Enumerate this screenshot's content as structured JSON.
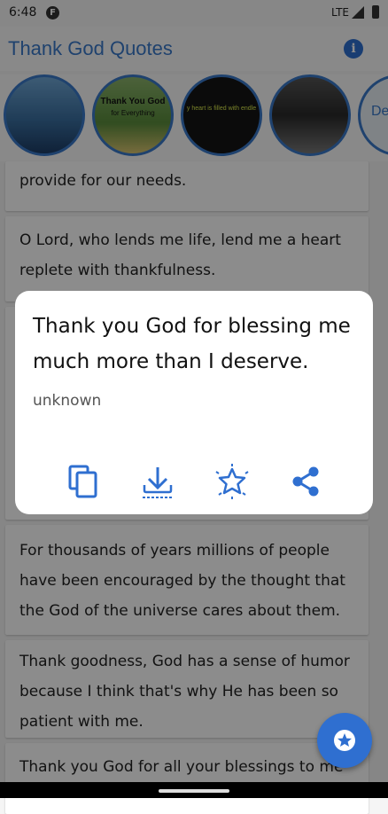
{
  "status": {
    "time": "6:48",
    "app_icon": "F",
    "network": "LTE"
  },
  "app": {
    "title": "Thank God Quotes",
    "info_icon": "i"
  },
  "stories": [
    {
      "caption": ""
    },
    {
      "caption_line1": "Thank You God",
      "caption_line2": "for Everything"
    },
    {
      "caption": "y heart is filled with endle"
    },
    {
      "caption": ""
    },
    {
      "caption": "De"
    }
  ],
  "quotes": [
    "provide for our needs.",
    "O Lord, who lends me life, lend me a heart replete with thankfulness.",
    "For thousands of years millions of people have been encouraged by the thought that the God of the universe cares about them.",
    "Thank goodness, God has a sense of humor because I think that's why He has been so patient with me.",
    "Thank you God for all your blessings to me"
  ],
  "dialog": {
    "quote": "Thank you God for blessing me much more than I deserve.",
    "author": "unknown",
    "actions": [
      "copy-icon",
      "download-icon",
      "favorite-star-icon",
      "share-icon"
    ]
  },
  "colors": {
    "accent": "#2f6fd0",
    "title": "#3a78c9"
  }
}
